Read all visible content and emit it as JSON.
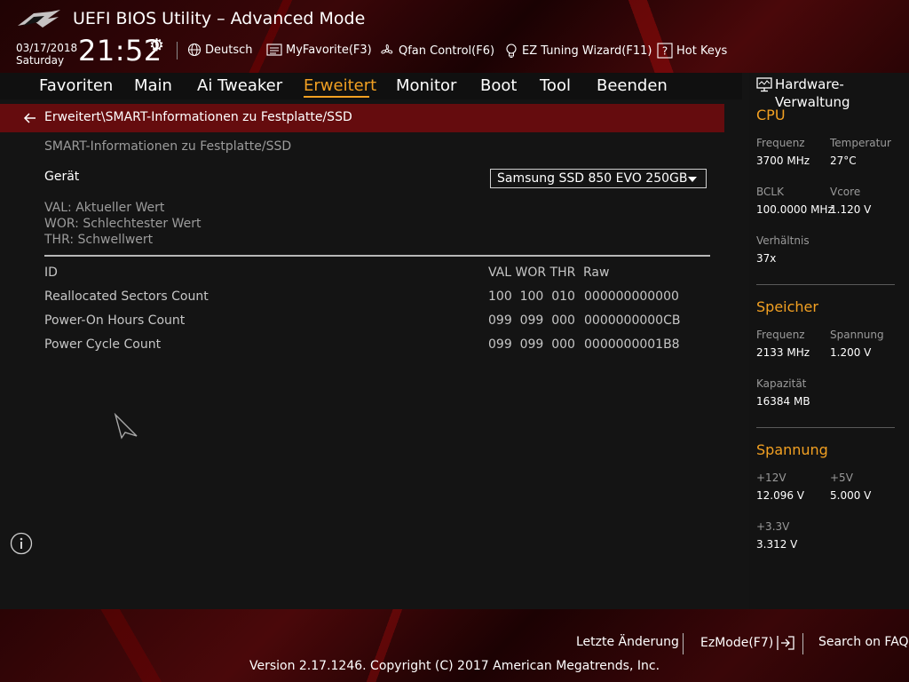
{
  "header": {
    "title": "UEFI BIOS Utility – Advanced Mode",
    "date": "03/17/2018",
    "weekday": "Saturday",
    "time": "21:52",
    "tools": [
      {
        "label": "Deutsch",
        "icon": "globe-icon"
      },
      {
        "label": "MyFavorite(F3)",
        "icon": "favorite-list-icon"
      },
      {
        "label": "Qfan Control(F6)",
        "icon": "fan-icon"
      },
      {
        "label": "EZ Tuning Wizard(F11)",
        "icon": "lightbulb-icon"
      },
      {
        "label": "Hot Keys",
        "icon": "question-key-icon"
      }
    ]
  },
  "nav": {
    "tabs": [
      "Favoriten",
      "Main",
      "Ai Tweaker",
      "Erweitert",
      "Monitor",
      "Boot",
      "Tool",
      "Beenden"
    ],
    "active": "Erweitert"
  },
  "breadcrumb": "Erweitert\\SMART-Informationen zu Festplatte/SSD",
  "main": {
    "subtitle": "SMART-Informationen zu Festplatte/SSD",
    "device_label": "Gerät",
    "device_value": "Samsung SSD 850 EVO 250GB",
    "legend": [
      "VAL: Aktueller Wert",
      "WOR: Schlechtester Wert",
      "THR: Schwellwert"
    ],
    "table": {
      "headers": [
        "ID",
        "VAL WOR THR",
        "Raw"
      ],
      "rows": [
        {
          "id": "Reallocated Sectors Count",
          "vals": "100  100  010",
          "raw": "000000000000"
        },
        {
          "id": "Power-On Hours Count",
          "vals": "099  099  000",
          "raw": "0000000000CB"
        },
        {
          "id": "Power Cycle Count",
          "vals": "099  099  000",
          "raw": "0000000001B8"
        }
      ]
    }
  },
  "hardware": {
    "title": "Hardware-Verwaltung",
    "cpu": {
      "title": "CPU",
      "freq_label": "Frequenz",
      "freq": "3700 MHz",
      "temp_label": "Temperatur",
      "temp": "27°C",
      "bclk_label": "BCLK",
      "bclk": "100.0000 MHz",
      "vcore_label": "Vcore",
      "vcore": "1.120 V",
      "ratio_label": "Verhältnis",
      "ratio": "37x"
    },
    "memory": {
      "title": "Speicher",
      "freq_label": "Frequenz",
      "freq": "2133 MHz",
      "volt_label": "Spannung",
      "volt": "1.200 V",
      "cap_label": "Kapazität",
      "cap": "16384 MB"
    },
    "voltage": {
      "title": "Spannung",
      "v12_label": "+12V",
      "v12": "12.096 V",
      "v5_label": "+5V",
      "v5": "5.000 V",
      "v33_label": "+3.3V",
      "v33": "3.312 V"
    }
  },
  "footer": {
    "last_change": "Letzte Änderung",
    "ezmode": "EzMode(F7)",
    "faq": "Search on FAQ",
    "copyright": "Version 2.17.1246. Copyright (C) 2017 American Megatrends, Inc."
  },
  "colors": {
    "accent": "#f2a022",
    "breadcrumb_bg": "#650c0e",
    "panel_bg": "#141414"
  }
}
